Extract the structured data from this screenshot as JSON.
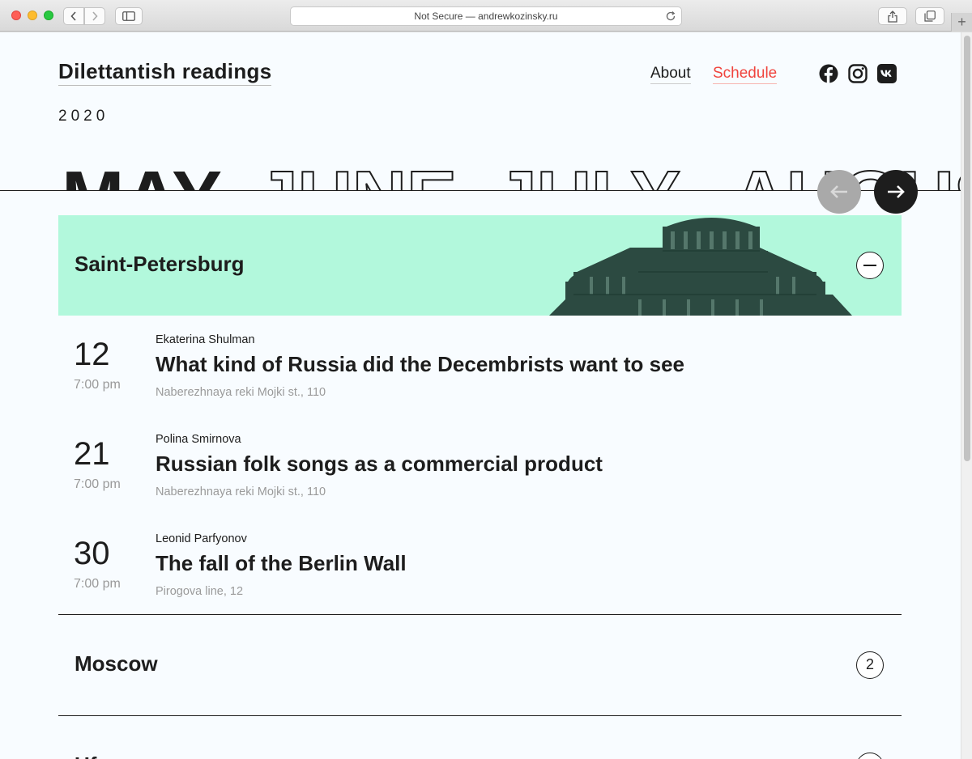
{
  "browser": {
    "address": "Not Secure — andrewkozinsky.ru",
    "new_tab": "+"
  },
  "header": {
    "site_title": "Dilettantish readings",
    "nav": [
      {
        "label": "About",
        "active": false
      },
      {
        "label": "Schedule",
        "active": true
      }
    ],
    "social": [
      "facebook-icon",
      "instagram-icon",
      "vk-icon"
    ]
  },
  "calendar": {
    "year": "2020",
    "months": [
      "MAY",
      "JUNE",
      "JULY",
      "AUGUST"
    ],
    "active_month": "MAY"
  },
  "cities": [
    {
      "name": "Saint-Petersburg",
      "expanded": true,
      "events": [
        {
          "day": "12",
          "time": "7:00 pm",
          "speaker": "Ekaterina Shulman",
          "title": "What kind of Russia did the Decembrists want to see",
          "place": "Naberezhnaya reki Mojki st., 110"
        },
        {
          "day": "21",
          "time": "7:00 pm",
          "speaker": "Polina Smirnova",
          "title": "Russian folk songs as a commercial product",
          "place": "Naberezhnaya reki Mojki st., 110"
        },
        {
          "day": "30",
          "time": "7:00 pm",
          "speaker": "Leonid Parfyonov",
          "title": "The fall of the Berlin Wall",
          "place": "Pirogova line, 12"
        }
      ]
    },
    {
      "name": "Moscow",
      "expanded": false,
      "count": "2"
    },
    {
      "name": "Uf",
      "expanded": false
    }
  ],
  "colors": {
    "accent": "#f0443d",
    "city_bar": "#b2f8dc",
    "text": "#1d1d1d",
    "muted": "#9a9a9a"
  }
}
